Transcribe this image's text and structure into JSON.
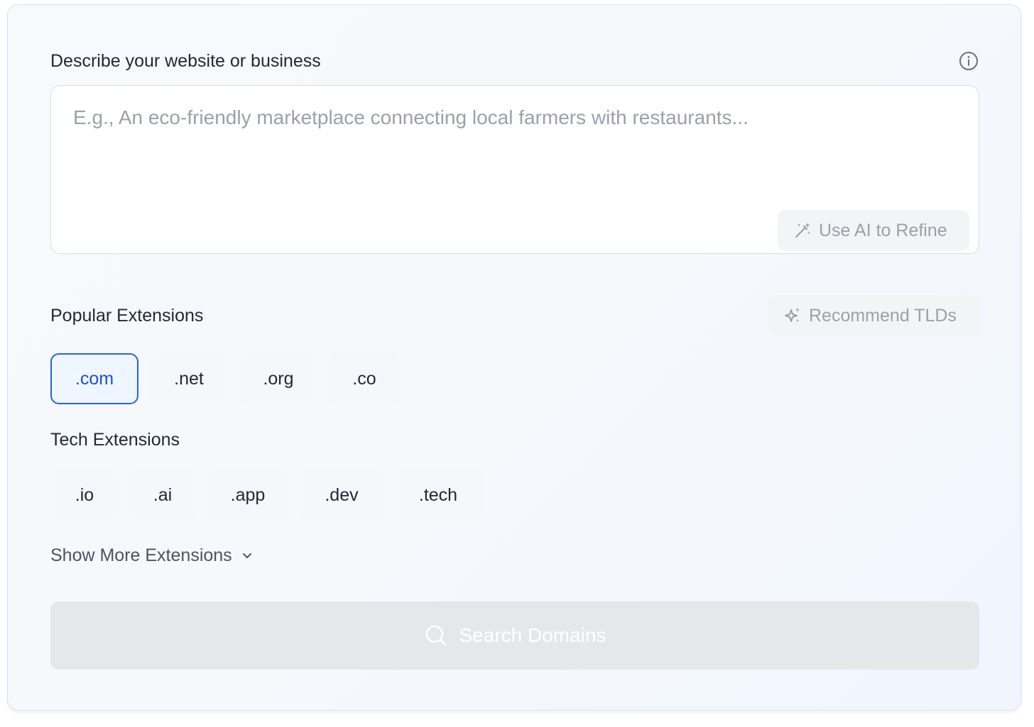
{
  "form": {
    "description_label": "Describe your website or business",
    "description_placeholder": "E.g., An eco-friendly marketplace connecting local farmers with restaurants...",
    "description_value": "",
    "refine_button": "Use AI to Refine",
    "popular_label": "Popular Extensions",
    "recommend_button": "Recommend TLDs",
    "popular_extensions": [
      ".com",
      ".net",
      ".org",
      ".co"
    ],
    "selected_extension": ".com",
    "tech_label": "Tech Extensions",
    "tech_extensions": [
      ".io",
      ".ai",
      ".app",
      ".dev",
      ".tech"
    ],
    "show_more": "Show More Extensions",
    "search_button": "Search Domains"
  },
  "icons": {
    "info": "info-circle-icon",
    "refine": "magic-wand-icon",
    "recommend": "sparkles-icon",
    "show_more": "chevron-down-icon",
    "search": "search-icon"
  },
  "colors": {
    "accent": "#2563eb",
    "selected_bg": "#eff6ff",
    "disabled_bg": "#e5e7eb",
    "muted_text": "#9aa1ab"
  }
}
